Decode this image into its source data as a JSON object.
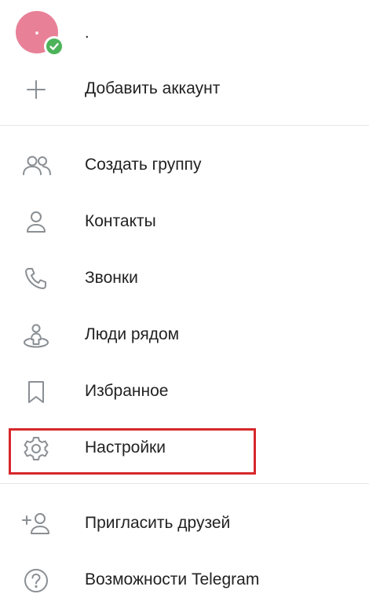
{
  "account": {
    "name": "."
  },
  "menu": {
    "add_account": "Добавить аккаунт",
    "items": [
      {
        "label": "Создать группу",
        "icon": "group-icon"
      },
      {
        "label": "Контакты",
        "icon": "contact-icon"
      },
      {
        "label": "Звонки",
        "icon": "phone-icon"
      },
      {
        "label": "Люди рядом",
        "icon": "people-nearby-icon"
      },
      {
        "label": "Избранное",
        "icon": "bookmark-icon"
      },
      {
        "label": "Настройки",
        "icon": "gear-icon"
      }
    ],
    "invite_friends": "Пригласить друзей",
    "features": "Возможности Telegram"
  },
  "colors": {
    "avatar": "#e88098",
    "badge": "#4cb35a",
    "highlight": "#d7272b",
    "icon": "#8a8f94"
  }
}
